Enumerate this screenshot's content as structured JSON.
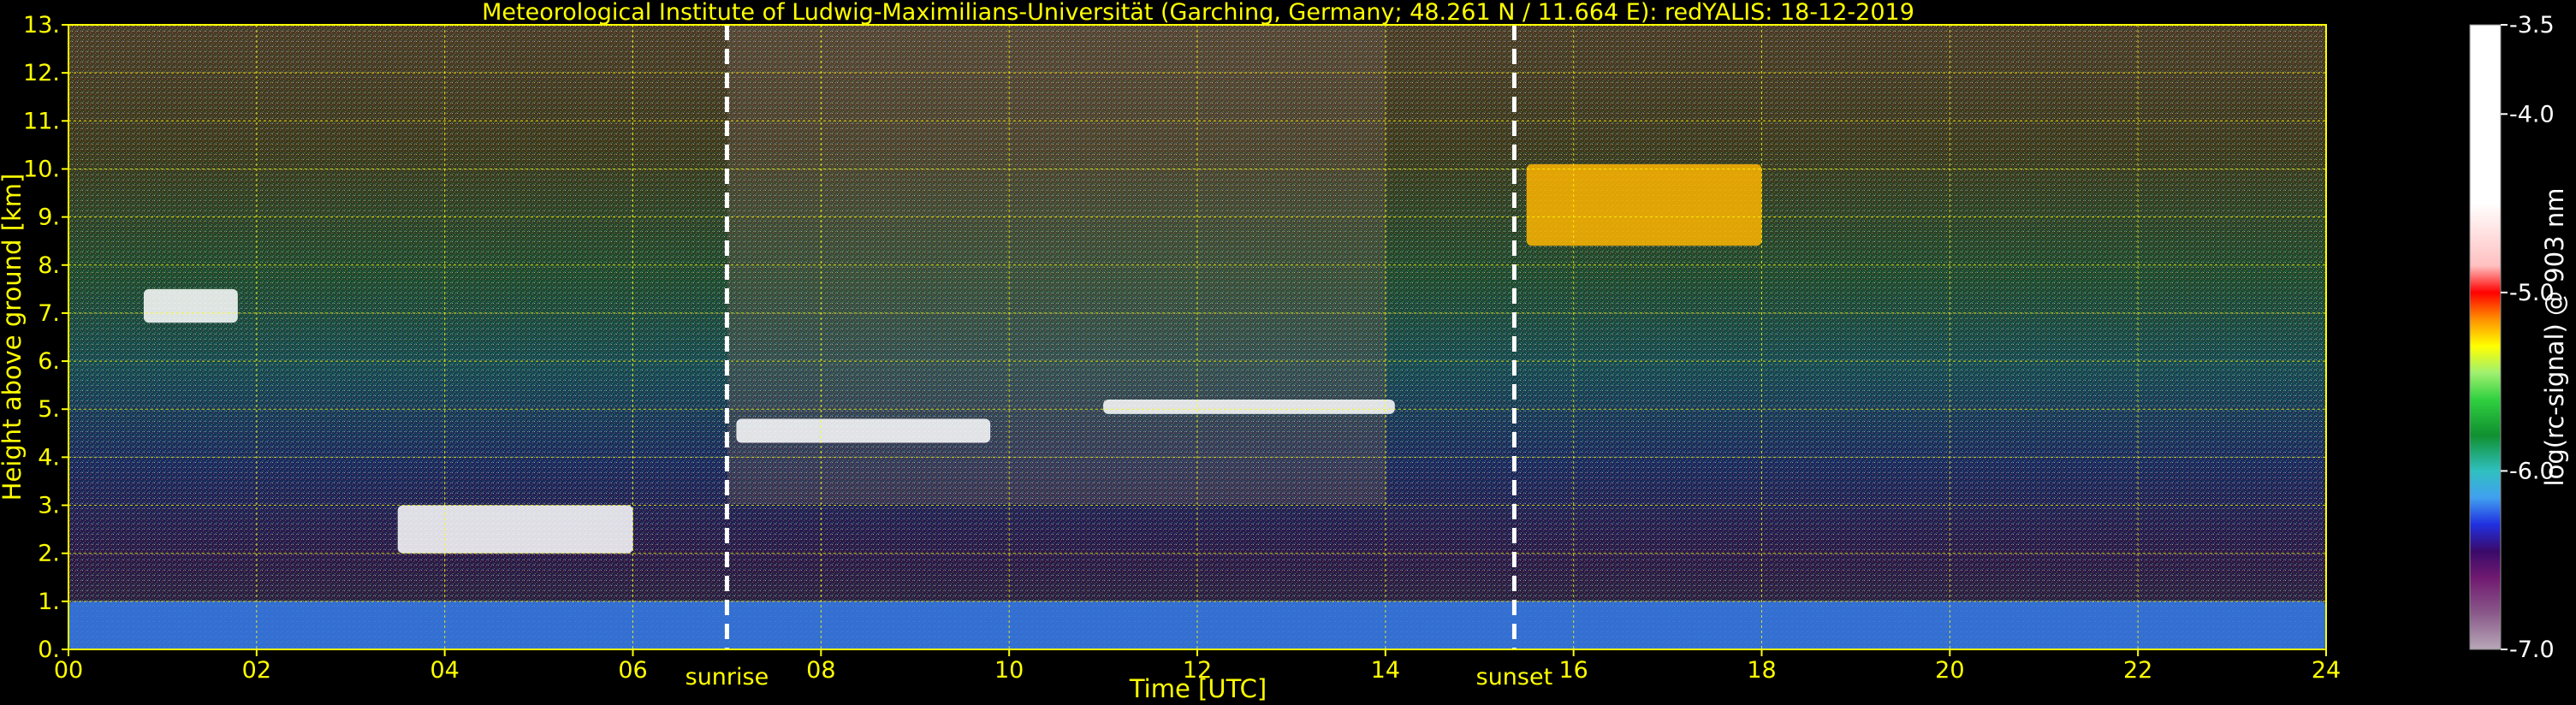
{
  "chart_data": {
    "type": "heatmap",
    "title": "Meteorological Institute of Ludwig-Maximilians-Universität (Garching, Germany; 48.261 N / 11.664 E):    redYALIS: 18-12-2019",
    "xlabel": "Time [UTC]",
    "ylabel": "Height above ground [km]",
    "xlim": [
      0,
      24
    ],
    "ylim": [
      0,
      13
    ],
    "x_ticks": [
      {
        "value": 0,
        "label": "00"
      },
      {
        "value": 2,
        "label": "02"
      },
      {
        "value": 4,
        "label": "04"
      },
      {
        "value": 6,
        "label": "06"
      },
      {
        "value": 8,
        "label": "08"
      },
      {
        "value": 10,
        "label": "10"
      },
      {
        "value": 12,
        "label": "12"
      },
      {
        "value": 14,
        "label": "14"
      },
      {
        "value": 16,
        "label": "16"
      },
      {
        "value": 18,
        "label": "18"
      },
      {
        "value": 20,
        "label": "20"
      },
      {
        "value": 22,
        "label": "22"
      },
      {
        "value": 24,
        "label": "24"
      }
    ],
    "y_ticks": [
      {
        "value": 0,
        "label": "0."
      },
      {
        "value": 1,
        "label": "1."
      },
      {
        "value": 2,
        "label": "2."
      },
      {
        "value": 3,
        "label": "3."
      },
      {
        "value": 4,
        "label": "4."
      },
      {
        "value": 5,
        "label": "5."
      },
      {
        "value": 6,
        "label": "6."
      },
      {
        "value": 7,
        "label": "7."
      },
      {
        "value": 8,
        "label": "8."
      },
      {
        "value": 9,
        "label": "9."
      },
      {
        "value": 10,
        "label": "10."
      },
      {
        "value": 11,
        "label": "11."
      },
      {
        "value": 12,
        "label": "12."
      },
      {
        "value": 13,
        "label": "13."
      }
    ],
    "grid": true,
    "grid_color": "#ffff00",
    "annotations": [
      {
        "name": "sunrise",
        "label": "sunrise",
        "x": 7.0
      },
      {
        "name": "sunset",
        "label": "sunset",
        "x": 15.37
      }
    ],
    "colorbar": {
      "label": "log(rc-signal) @ 903 nm",
      "range": [
        -7.0,
        -3.5
      ],
      "ticks": [
        {
          "value": -3.5,
          "label": "-3.5"
        },
        {
          "value": -4.0,
          "label": "-4.0"
        },
        {
          "value": -5.0,
          "label": "-5.0"
        },
        {
          "value": -6.0,
          "label": "-6.0"
        },
        {
          "value": -7.0,
          "label": "-7.0"
        }
      ],
      "stops": [
        {
          "value": -7.0,
          "color": "#b8a8b8"
        },
        {
          "value": -6.8,
          "color": "#8a5a8a"
        },
        {
          "value": -6.6,
          "color": "#701a70"
        },
        {
          "value": -6.45,
          "color": "#3a0a6a"
        },
        {
          "value": -6.3,
          "color": "#2030e0"
        },
        {
          "value": -6.15,
          "color": "#40a0f0"
        },
        {
          "value": -6.0,
          "color": "#30c0c0"
        },
        {
          "value": -5.8,
          "color": "#109030"
        },
        {
          "value": -5.6,
          "color": "#30d040"
        },
        {
          "value": -5.45,
          "color": "#a0f070"
        },
        {
          "value": -5.3,
          "color": "#ffff00"
        },
        {
          "value": -5.15,
          "color": "#ff9000"
        },
        {
          "value": -5.0,
          "color": "#ff0000"
        },
        {
          "value": -4.85,
          "color": "#ffc0c0"
        },
        {
          "value": -4.5,
          "color": "#ffffff"
        },
        {
          "value": -3.5,
          "color": "#ffffff"
        }
      ]
    },
    "features": [
      {
        "name": "boundary-layer",
        "x": [
          0,
          24
        ],
        "y": [
          0,
          1.0
        ],
        "value": -6.2
      },
      {
        "name": "cloud-layer-low",
        "x": [
          3.5,
          6.0
        ],
        "y": [
          2.0,
          3.0
        ],
        "value": -4.5
      },
      {
        "name": "cloud-layer-mid",
        "x": [
          7.1,
          9.8
        ],
        "y": [
          4.3,
          4.8
        ],
        "value": -4.3
      },
      {
        "name": "cloud-layer-5km",
        "x": [
          11.0,
          14.1
        ],
        "y": [
          4.9,
          5.2
        ],
        "value": -4.3
      },
      {
        "name": "cirrus-night",
        "x": [
          0.8,
          1.8
        ],
        "y": [
          6.8,
          7.5
        ],
        "value": -4.5
      },
      {
        "name": "cirrus-evening",
        "x": [
          15.5,
          18.0
        ],
        "y": [
          8.4,
          10.1
        ],
        "value": -5.2
      }
    ]
  }
}
